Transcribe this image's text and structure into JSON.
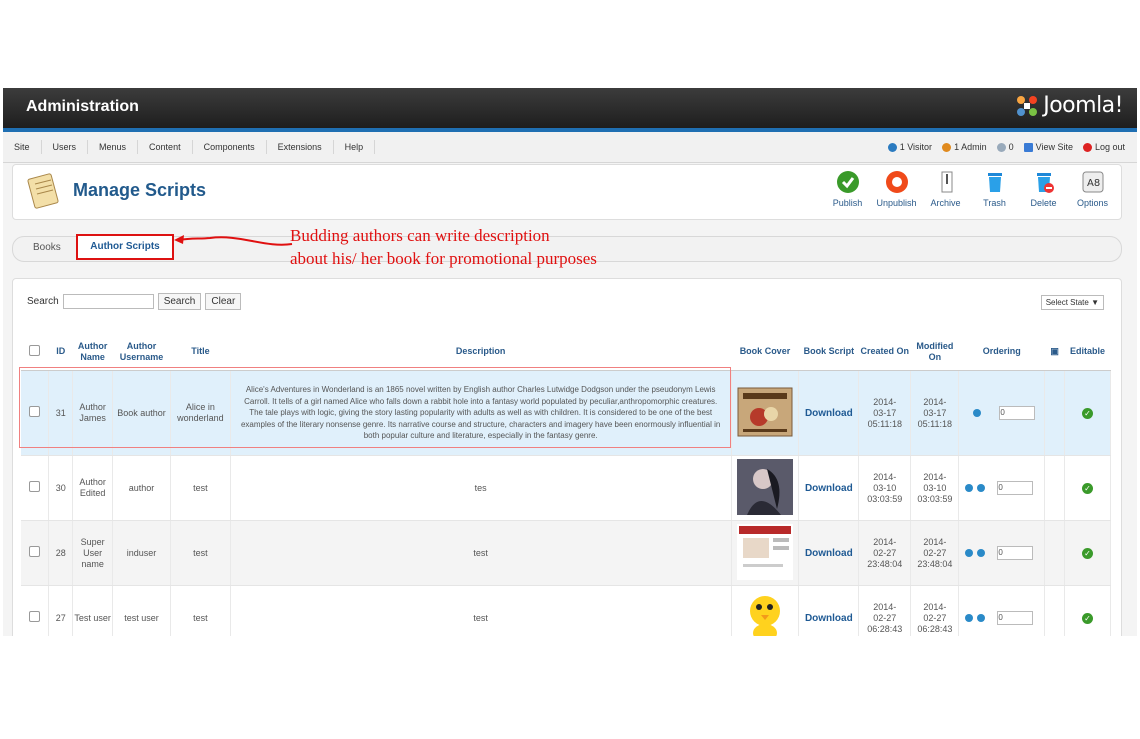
{
  "header": {
    "title": "Administration",
    "logo": "Joomla!"
  },
  "menu": [
    "Site",
    "Users",
    "Menus",
    "Content",
    "Components",
    "Extensions",
    "Help"
  ],
  "status": {
    "visitor": "1 Visitor",
    "admin": "1 Admin",
    "messages": "0",
    "view_site": "View Site",
    "logout": "Log out"
  },
  "page_title": "Manage Scripts",
  "toolbar": [
    {
      "label": "Publish",
      "icon": "publish-icon"
    },
    {
      "label": "Unpublish",
      "icon": "unpublish-icon"
    },
    {
      "label": "Archive",
      "icon": "archive-icon"
    },
    {
      "label": "Trash",
      "icon": "trash-icon"
    },
    {
      "label": "Delete",
      "icon": "delete-icon"
    },
    {
      "label": "Options",
      "icon": "options-icon"
    }
  ],
  "subnav": {
    "books": "Books",
    "author_scripts": "Author Scripts"
  },
  "annotation": {
    "line1": "Budding authors can write description",
    "line2": "about his/ her book for promotional purposes"
  },
  "filter": {
    "label": "Search",
    "search_btn": "Search",
    "clear_btn": "Clear",
    "select_state": "Select State"
  },
  "columns": {
    "id": "ID",
    "author_name": "Author Name",
    "author_username": "Author Username",
    "title": "Title",
    "description": "Description",
    "book_cover": "Book Cover",
    "book_script": "Book Script",
    "created": "Created On",
    "modified": "Modified On",
    "ordering": "Ordering",
    "editable": "Editable"
  },
  "rows": [
    {
      "id": "31",
      "author_name": "Author James",
      "username": "Book author",
      "title": "Alice in wonderland",
      "description": "Alice's Adventures in Wonderland is an 1865 novel written by English author Charles Lutwidge Dodgson under the pseudonym Lewis Carroll. It tells of a girl named Alice who falls down a rabbit hole into a fantasy world populated by peculiar,anthropomorphic creatures. The tale plays with logic, giving the story lasting popularity with adults as well as with children. It is considered to be one of the best examples of the literary nonsense genre. Its narrative course and structure, characters and imagery have been enormously influential in both popular culture and literature, especially in the fantasy genre.",
      "script": "Download",
      "created": "2014-03-17 05:11:18",
      "modified": "2014-03-17 05:11:18",
      "order": "0"
    },
    {
      "id": "30",
      "author_name": "Author Edited",
      "username": "author",
      "title": "test",
      "description": "tes",
      "script": "Download",
      "created": "2014-03-10 03:03:59",
      "modified": "2014-03-10 03:03:59",
      "order": "0"
    },
    {
      "id": "28",
      "author_name": "Super User name",
      "username": "induser",
      "title": "test",
      "description": "test",
      "script": "Download",
      "created": "2014-02-27 23:48:04",
      "modified": "2014-02-27 23:48:04",
      "order": "0"
    },
    {
      "id": "27",
      "author_name": "Test user",
      "username": "test user",
      "title": "test",
      "description": "test",
      "script": "Download",
      "created": "2014-02-27 06:28:43",
      "modified": "2014-02-27 06:28:43",
      "order": "0"
    }
  ],
  "colors": {
    "accent": "#1f6fb2",
    "annotation": "#e01010"
  }
}
